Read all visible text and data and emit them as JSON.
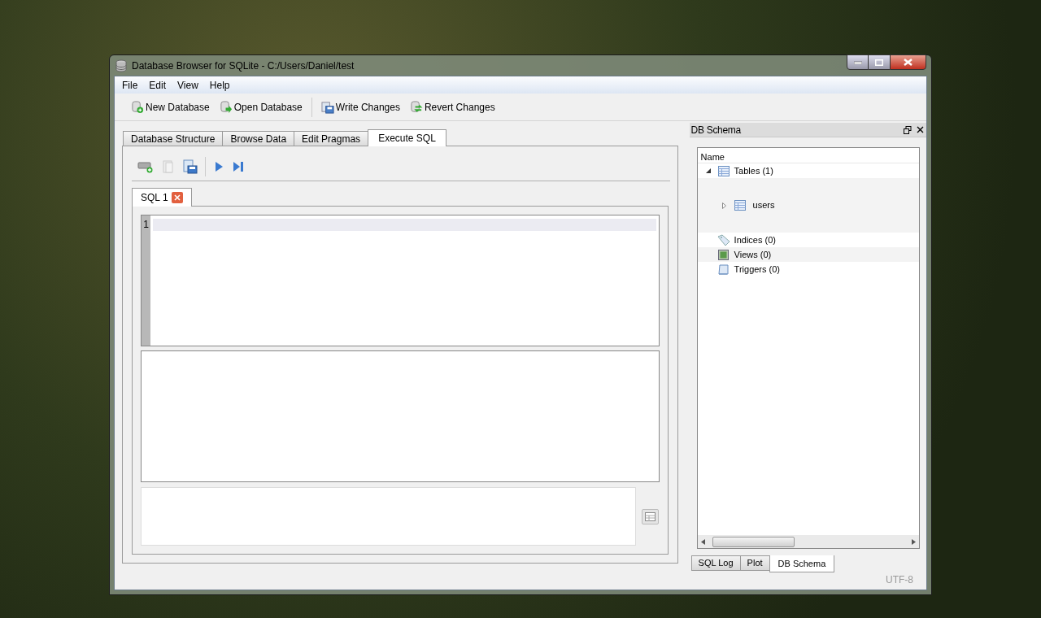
{
  "window": {
    "title": "Database Browser for SQLite - C:/Users/Daniel/test"
  },
  "menu": [
    "File",
    "Edit",
    "View",
    "Help"
  ],
  "toolbar": [
    {
      "kind": "new",
      "label": "New Database"
    },
    {
      "kind": "open",
      "label": "Open Database"
    },
    {
      "kind": "write",
      "label": "Write Changes"
    },
    {
      "kind": "revert",
      "label": "Revert Changes"
    }
  ],
  "tabs": [
    {
      "label": "Database Structure",
      "selected": false
    },
    {
      "label": "Browse Data",
      "selected": false
    },
    {
      "label": "Edit Pragmas",
      "selected": false
    },
    {
      "label": "Execute SQL",
      "selected": true
    }
  ],
  "editor_tabs": [
    {
      "label": "SQL 1",
      "selected": true
    }
  ],
  "editor": {
    "line_numbers": [
      "1"
    ]
  },
  "schema_panel": {
    "title": "DB Schema",
    "column": "Name",
    "tree": [
      {
        "kind": "tables",
        "label": "Tables (1)",
        "expanded": true,
        "children": [
          {
            "kind": "table",
            "label": "users",
            "expanded": false
          }
        ]
      },
      {
        "kind": "indices",
        "label": "Indices (0)"
      },
      {
        "kind": "views",
        "label": "Views (0)"
      },
      {
        "kind": "triggers",
        "label": "Triggers (0)"
      }
    ]
  },
  "dock_tabs": [
    {
      "label": "SQL Log",
      "selected": false
    },
    {
      "label": "Plot",
      "selected": false
    },
    {
      "label": "DB Schema",
      "selected": true
    }
  ],
  "status_bar": {
    "encoding": "UTF-8"
  }
}
